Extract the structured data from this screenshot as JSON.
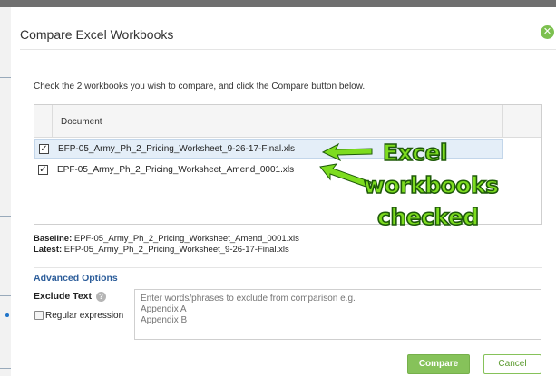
{
  "dialog": {
    "title": "Compare Excel Workbooks",
    "instructions": "Check the 2 workbooks you wish to compare, and click the Compare button below."
  },
  "grid": {
    "header": "Document",
    "rows": [
      {
        "name": "EFP-05_Army_Ph_2_Pricing_Worksheet_9-26-17-Final.xls",
        "checked": true,
        "selected": true
      },
      {
        "name": "EPF-05_Army_Ph_2_Pricing_Worksheet_Amend_0001.xls",
        "checked": true,
        "selected": false
      }
    ]
  },
  "summary": {
    "baseline_label": "Baseline:",
    "baseline_value": " EPF-05_Army_Ph_2_Pricing_Worksheet_Amend_0001.xls",
    "latest_label": "Latest:",
    "latest_value": " EFP-05_Army_Ph_2_Pricing_Worksheet_9-26-17-Final.xls"
  },
  "advanced": {
    "title": "Advanced Options",
    "exclude_label": "Exclude Text",
    "regex_label": "Regular expression",
    "regex_checked": false,
    "exclude_placeholder": "Enter words/phrases to exclude from comparison e.g.\nAppendix A\nAppendix B",
    "exclude_value": ""
  },
  "buttons": {
    "compare": "Compare",
    "cancel": "Cancel"
  },
  "annotation": {
    "line1": "Excel",
    "line2": "workbooks",
    "line3": "checked"
  },
  "icons": {
    "close": "close-icon",
    "info": "info-icon",
    "checkbox": "checkbox-icon"
  },
  "colors": {
    "accent_green": "#86c25a",
    "link_blue": "#2c5d9a",
    "row_selected": "#e4eef8",
    "annotation_green": "#7ddc1f"
  }
}
